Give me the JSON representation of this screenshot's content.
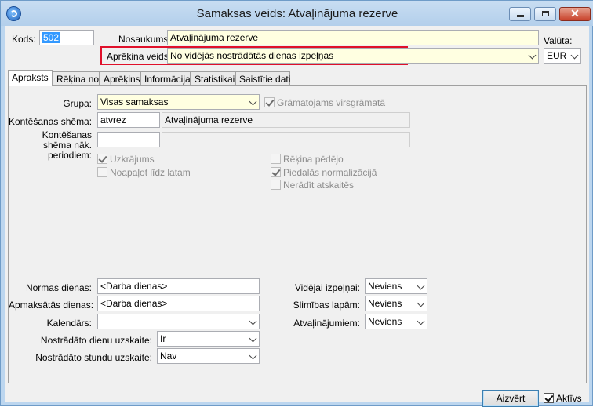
{
  "window": {
    "title": "Samaksas veids: Atvaļinājuma rezerve"
  },
  "header": {
    "kods_label": "Kods:",
    "kods_value": "502",
    "nosaukums_label": "Nosaukums:",
    "nosaukums_value": "Atvaļinājuma rezerve",
    "valuta_label": "Valūta:",
    "valuta_value": "EUR",
    "aprekina_label": "Aprēķina veids:",
    "aprekina_value": "No vidējās nostrādātās dienas izpeļņas"
  },
  "tabs": [
    {
      "label": "Apraksts"
    },
    {
      "label": "Rēķina no"
    },
    {
      "label": "Aprēķins"
    },
    {
      "label": "Informācija"
    },
    {
      "label": "Statistikai"
    },
    {
      "label": "Saistītie dati"
    }
  ],
  "form": {
    "grupa_label": "Grupa:",
    "grupa_value": "Visas samaksas",
    "gramatojams_label": "Grāmatojams virsgrāmatā",
    "kontes_label": "Kontēšanas shēma:",
    "kontes_code": "atvrez",
    "kontes_name": "Atvaļinājuma rezerve",
    "kontes_next_label_1": "Kontēšanas",
    "kontes_next_label_2": "shēma nāk.",
    "kontes_next_label_3": "periodiem:",
    "uzkrajums_label": "Uzkrājums",
    "noapalot_label": "Noapaļot līdz latam",
    "rekina_pedejo_label": "Rēķina pēdējo",
    "piedalas_label": "Piedalās normalizācijā",
    "neradit_label": "Nerādīt atskaitēs",
    "normas_label": "Normas dienas:",
    "normas_value": "<Darba dienas>",
    "apmaksatas_label": "Apmaksātās dienas:",
    "apmaksatas_value": "<Darba dienas>",
    "kalendars_label": "Kalendārs:",
    "kalendars_value": "",
    "nostr_dienu_label": "Nostrādāto dienu uzskaite:",
    "nostr_dienu_value": "Ir",
    "nostr_stundu_label": "Nostrādāto stundu uzskaite:",
    "nostr_stundu_value": "Nav",
    "videjai_label": "Vidējai izpeļņai:",
    "videjai_value": "Neviens",
    "slimibas_label": "Slimības lapām:",
    "slimibas_value": "Neviens",
    "atvalinajumiem_label": "Atvaļinājumiem:",
    "atvalinajumiem_value": "Neviens"
  },
  "footer": {
    "close_label": "Aizvērt",
    "aktivs_label": "Aktīvs"
  },
  "colors": {
    "highlight_border": "#e0102a",
    "required_field": "#ffffe1"
  }
}
